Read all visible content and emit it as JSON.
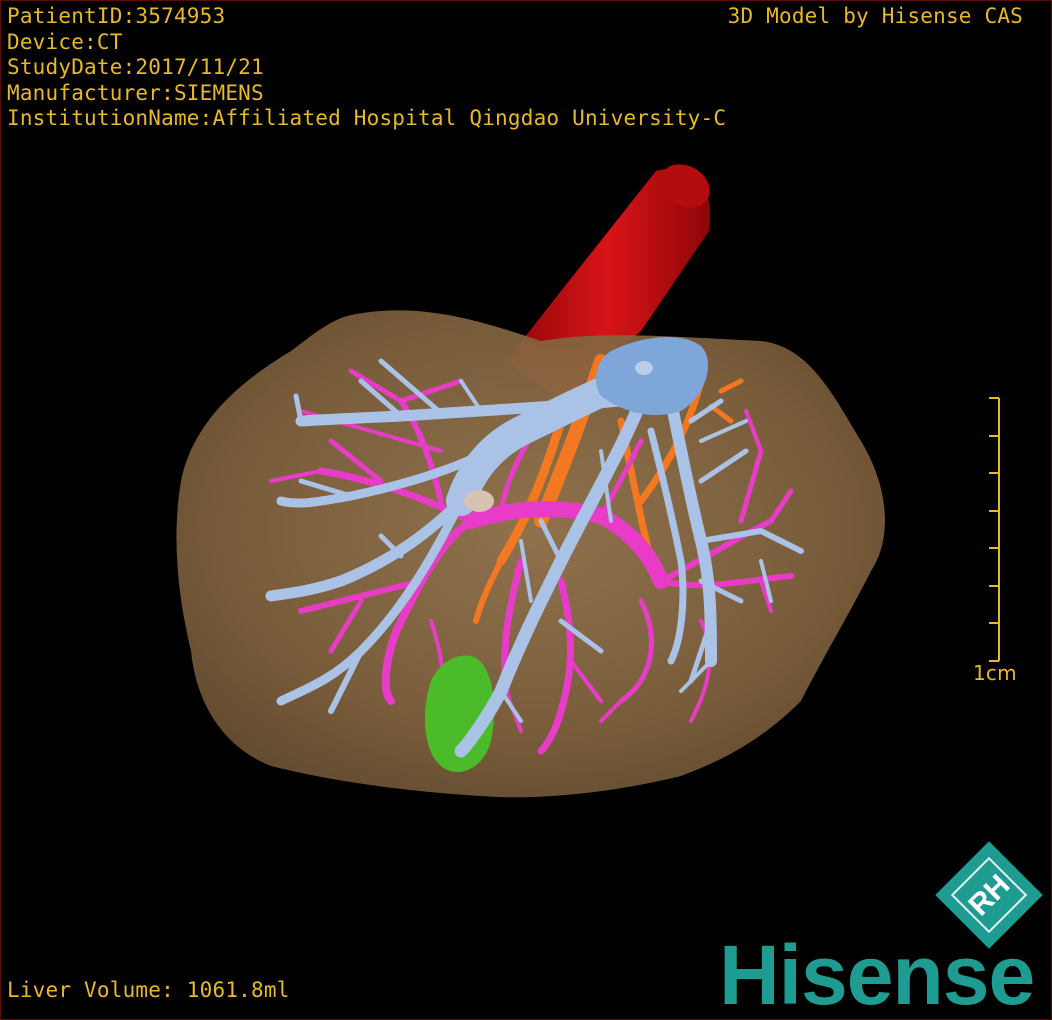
{
  "patient_info": {
    "patient_id": "PatientID:3574953",
    "device": "Device:CT",
    "study_date": "StudyDate:2017/11/21",
    "manufacturer": "Manufacturer:SIEMENS",
    "institution": "InstitutionName:Affiliated Hospital Qingdao University-C"
  },
  "brand_caption": "3D Model by Hisense CAS",
  "liver_volume": "Liver Volume: 1061.8ml",
  "scale_bar": {
    "label": "1cm",
    "ticks": 7
  },
  "logo": {
    "badge_text": "RH",
    "wordmark": "Hisense"
  },
  "colors": {
    "overlay_text": "#e8b828",
    "liver": "#8a6a44",
    "aorta": "#c40e12",
    "portal_vein": "#aac2e6",
    "vena_cava": "#7fa6d8",
    "hepatic_artery": "#e83cc8",
    "hepatic_vein": "#ff7a1e",
    "gallbladder": "#4bbb2a",
    "brand": "#1f9c91"
  }
}
